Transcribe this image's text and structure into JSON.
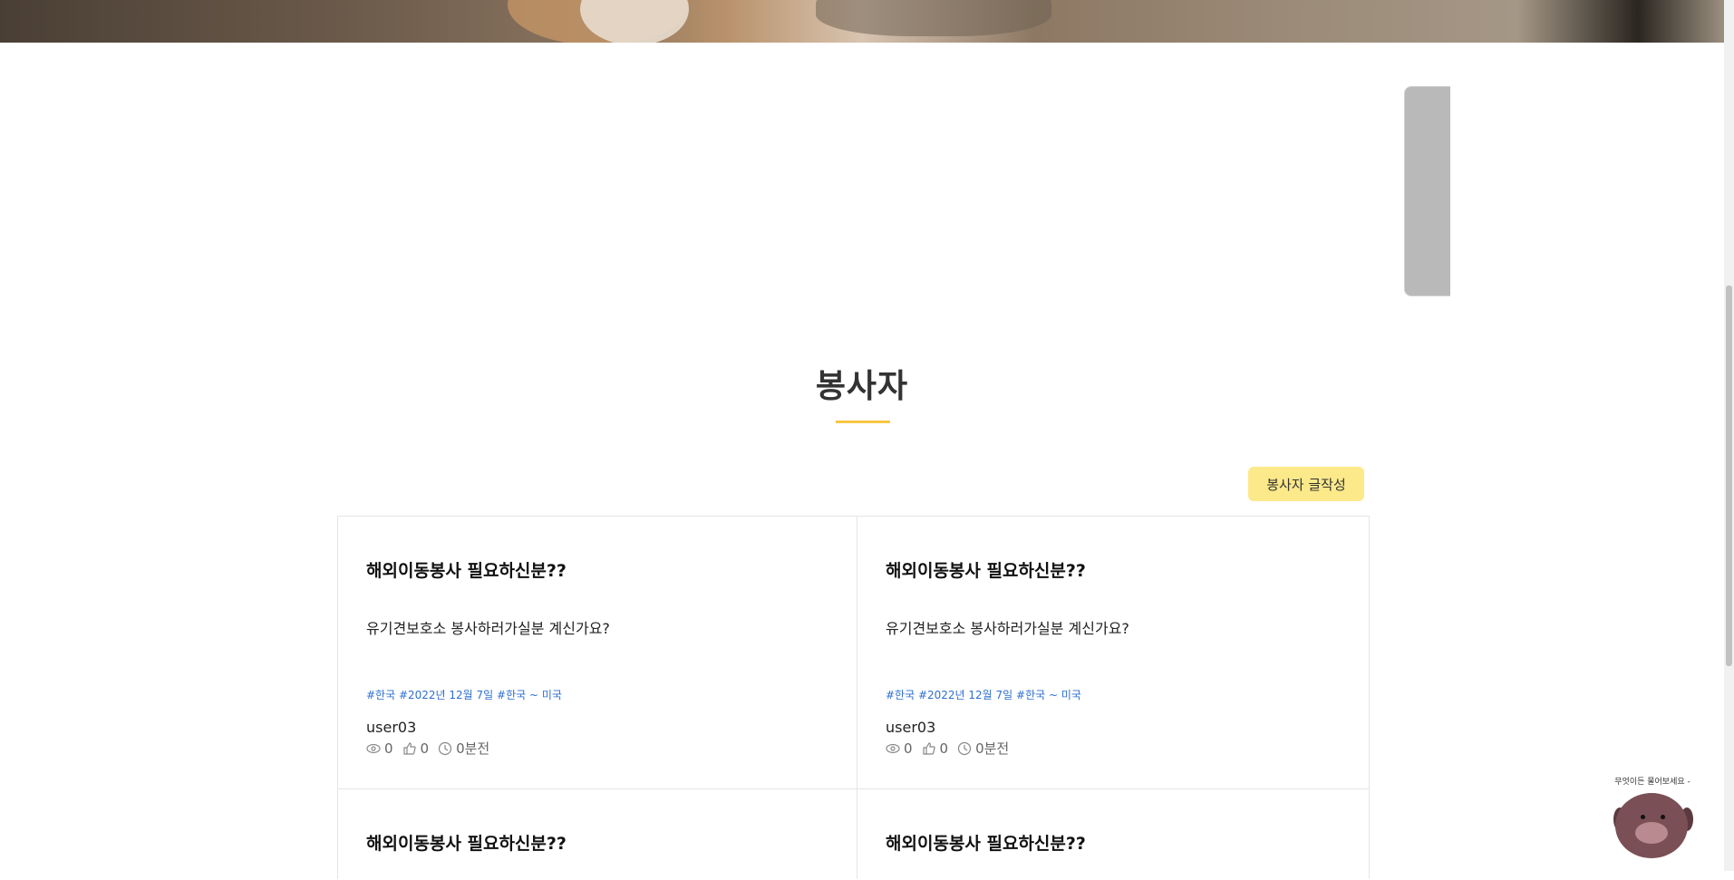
{
  "section": {
    "title": "봉사자",
    "write_button": "봉사자 글작성"
  },
  "cards": [
    {
      "title": "해외이동봉사 필요하신분??",
      "description": "유기견보호소 봉사하러가실분 계신가요?",
      "tags": "#한국 #2022년 12월 7일 #한국 ~ 미국",
      "author": "user03",
      "views": "0",
      "likes": "0",
      "time": "0분전"
    },
    {
      "title": "해외이동봉사 필요하신분??",
      "description": "유기견보호소 봉사하러가실분 계신가요?",
      "tags": "#한국 #2022년 12월 7일 #한국 ~ 미국",
      "author": "user03",
      "views": "0",
      "likes": "0",
      "time": "0분전"
    },
    {
      "title": "해외이동봉사 필요하신분??"
    },
    {
      "title": "해외이동봉사 필요하신분??"
    }
  ],
  "chatbot": {
    "caption": "무엇이든 물어보세요 -"
  },
  "icons": {
    "views": "eye-icon",
    "likes": "thumbs-up-icon",
    "time": "clock-icon"
  },
  "colors": {
    "accent_yellow": "#f7c744",
    "button_bg": "#fce98a",
    "tag_blue": "#2f6fd0"
  }
}
